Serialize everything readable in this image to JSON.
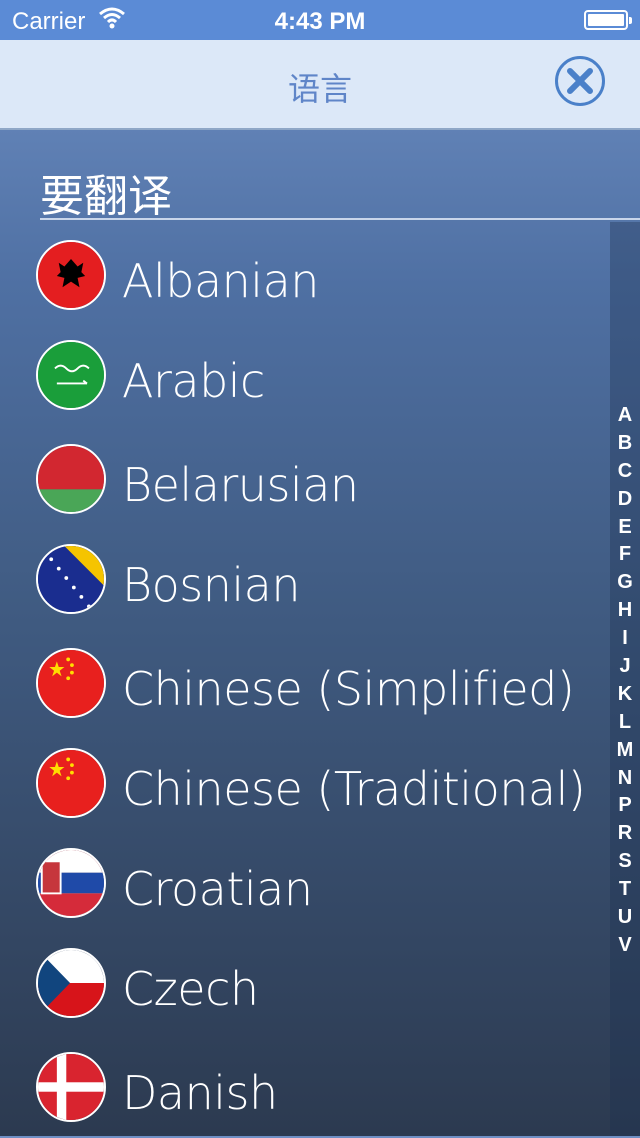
{
  "status": {
    "carrier": "Carrier",
    "time": "4:43 PM"
  },
  "nav": {
    "title": "语言",
    "close_icon": "close-x-circle-icon"
  },
  "section": {
    "header": "要翻译"
  },
  "languages": [
    {
      "name": "Albanian",
      "flag": "albania-flag-icon"
    },
    {
      "name": "Arabic",
      "flag": "saudi-arabia-flag-icon"
    },
    {
      "name": "Belarusian",
      "flag": "belarus-flag-icon"
    },
    {
      "name": "Bosnian",
      "flag": "bosnia-flag-icon"
    },
    {
      "name": "Chinese (Simplified)",
      "flag": "china-flag-icon"
    },
    {
      "name": "Chinese (Traditional)",
      "flag": "china-flag-icon"
    },
    {
      "name": "Croatian",
      "flag": "serbia-flag-icon"
    },
    {
      "name": "Czech",
      "flag": "czech-flag-icon"
    },
    {
      "name": "Danish",
      "flag": "denmark-flag-icon"
    }
  ],
  "index_letters": [
    "A",
    "B",
    "C",
    "D",
    "E",
    "F",
    "G",
    "H",
    "I",
    "J",
    "K",
    "L",
    "M",
    "N",
    "P",
    "R",
    "S",
    "T",
    "U",
    "V"
  ],
  "colors": {
    "accent": "#4a80c9",
    "nav_background": "#dce8f8",
    "status_bar": "#5b8bd6"
  }
}
